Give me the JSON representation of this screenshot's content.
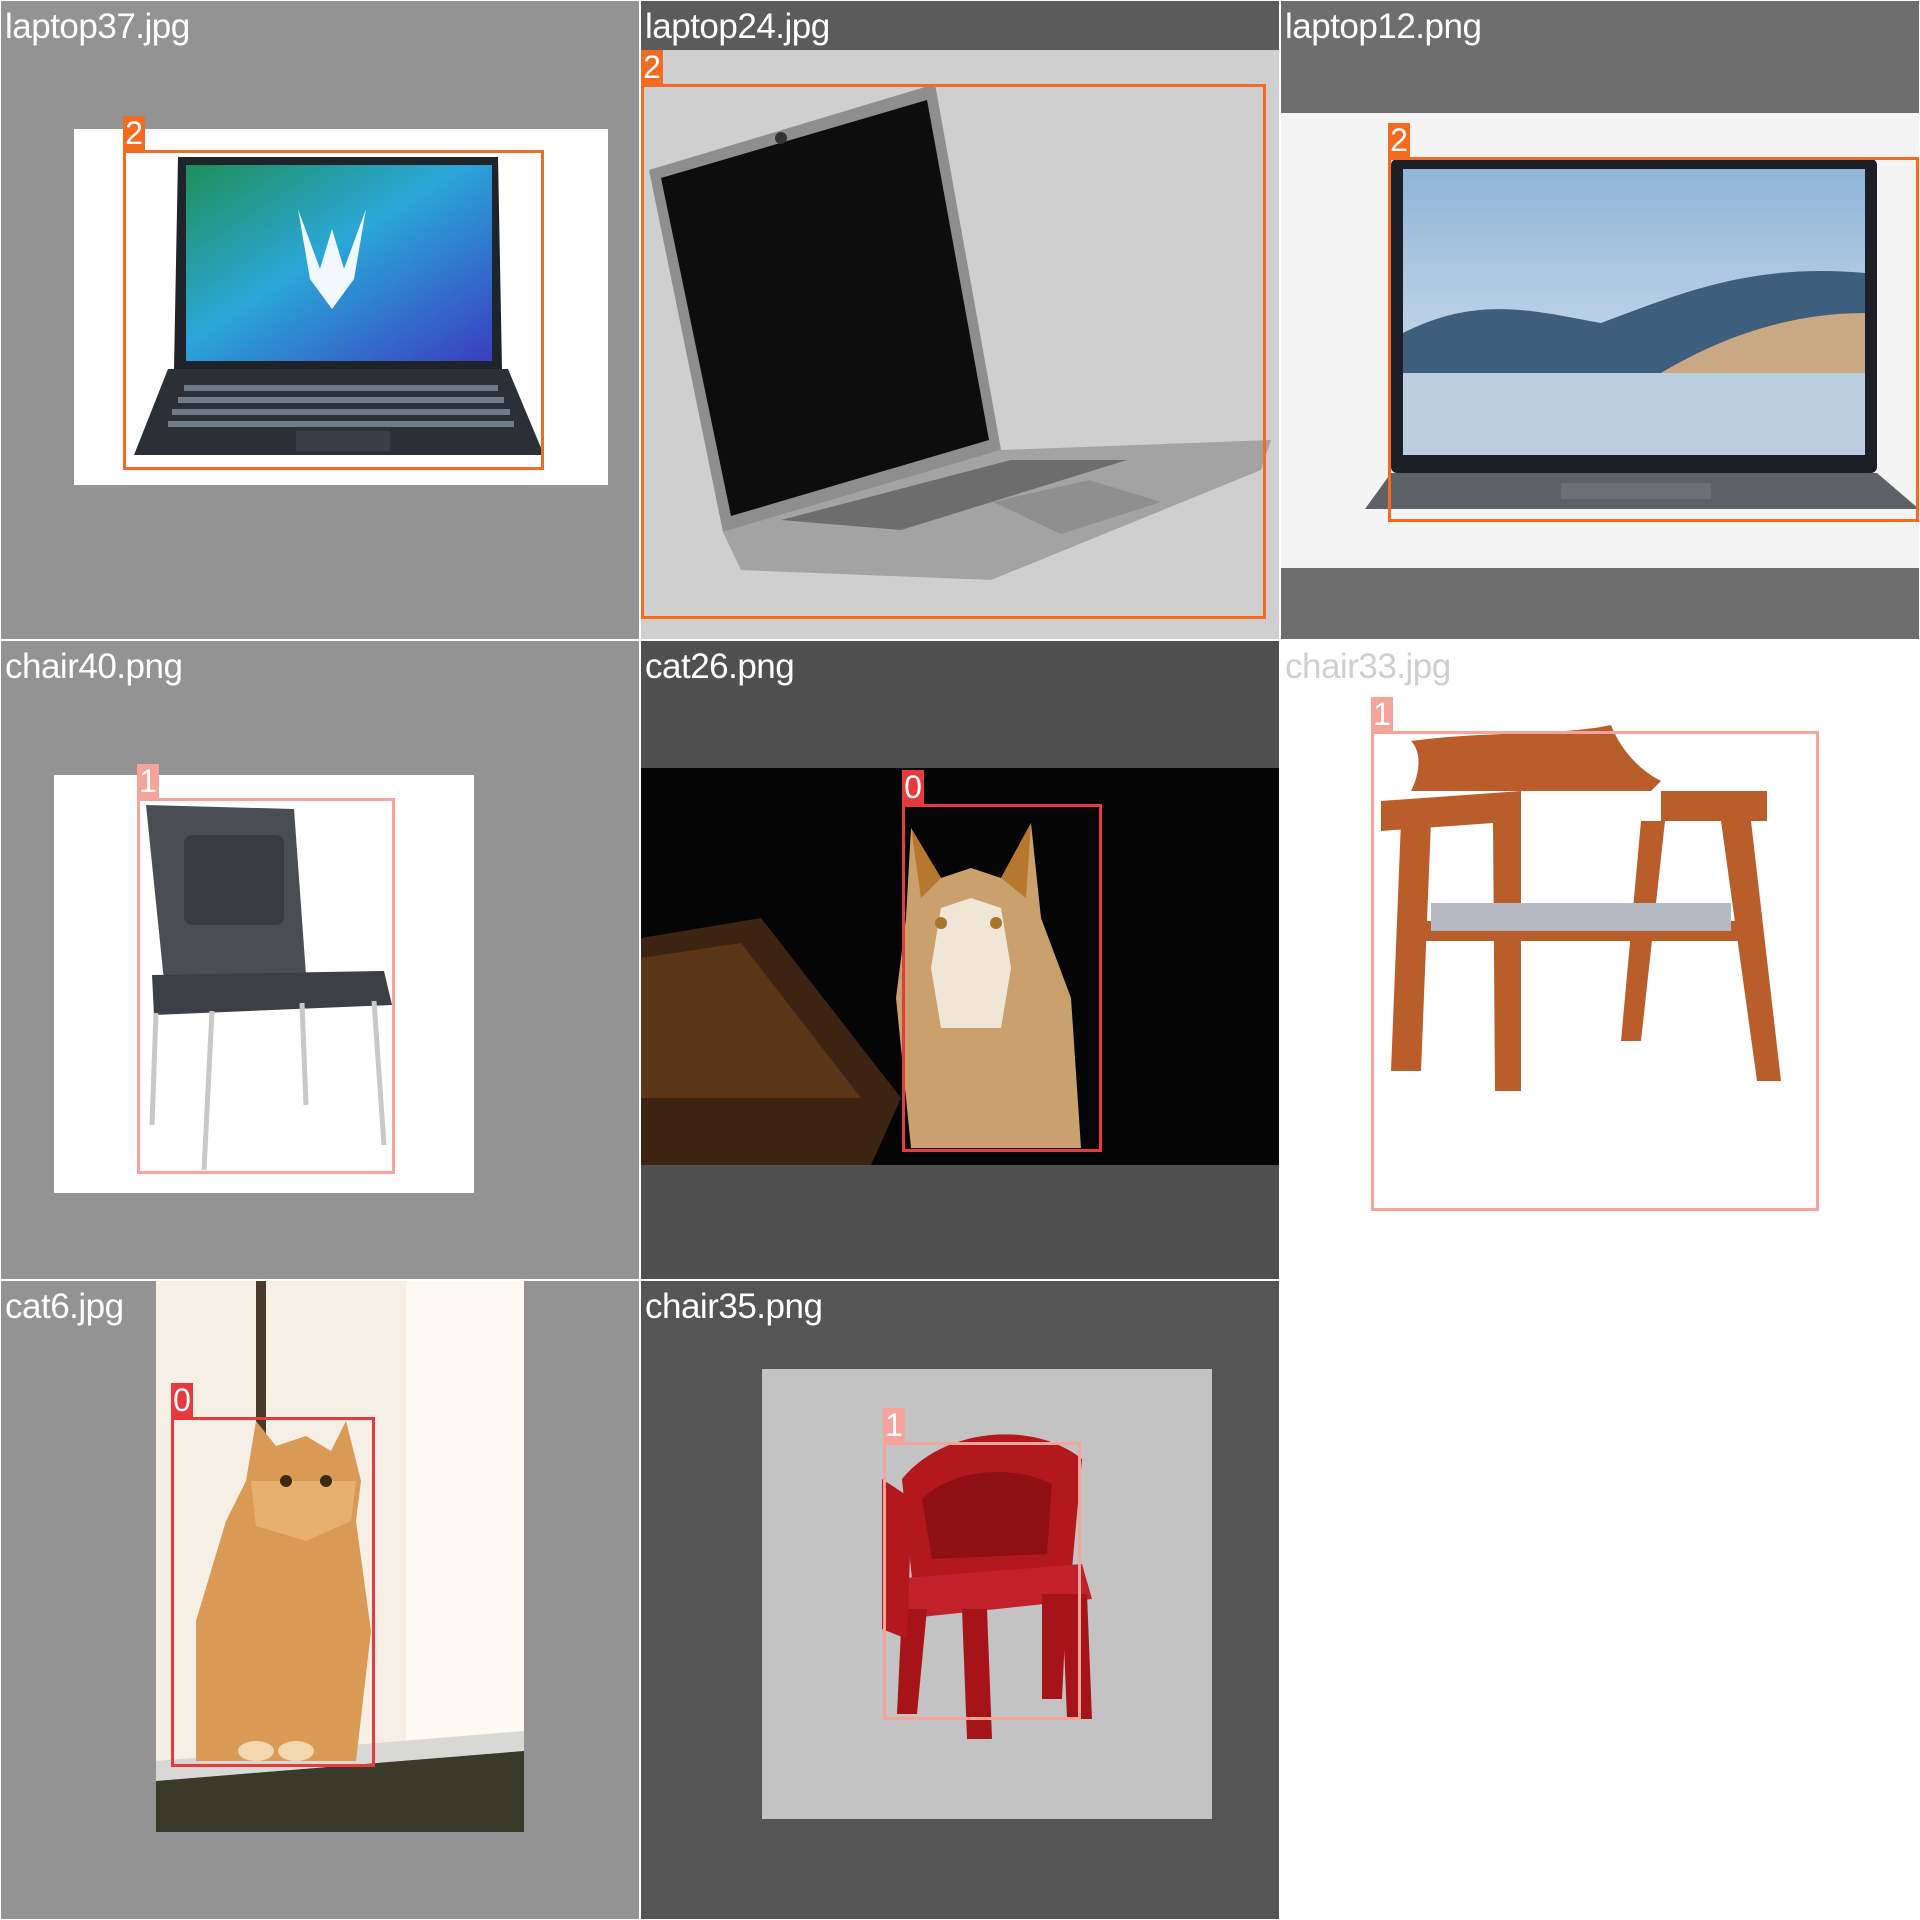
{
  "tiles": [
    {
      "filename": "laptop37.jpg",
      "label": "2"
    },
    {
      "filename": "laptop24.jpg",
      "label": "2"
    },
    {
      "filename": "laptop12.png",
      "label": "2"
    },
    {
      "filename": "chair40.png",
      "label": "1"
    },
    {
      "filename": "cat26.png",
      "label": "0"
    },
    {
      "filename": "chair33.jpg",
      "label": "1"
    },
    {
      "filename": "cat6.jpg",
      "label": "0"
    },
    {
      "filename": "chair35.png",
      "label": "1"
    }
  ],
  "colors": {
    "label_2_laptop": "#f26b21",
    "label_1_chair": "#f6a39b",
    "label_0_cat": "#e8393c"
  }
}
